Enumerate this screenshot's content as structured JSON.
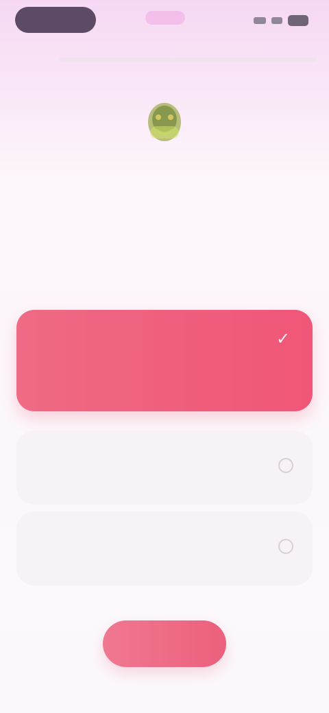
{
  "colors": {
    "accent": "#ef6a84",
    "background_top": "#f6d8f3",
    "background": "#fbf8fb",
    "option_background": "#f7f2f6"
  },
  "progress": {
    "value": 0.0
  },
  "icons": {
    "hero": "decorative-illustration-icon",
    "check": "check-icon",
    "radio": "radio-button-icon"
  },
  "question": {
    "title": "",
    "subtitle": ""
  },
  "options": [
    {
      "label": "",
      "selected": true
    },
    {
      "label": "",
      "selected": false
    },
    {
      "label": "",
      "selected": false
    }
  ],
  "cta": {
    "label": ""
  }
}
